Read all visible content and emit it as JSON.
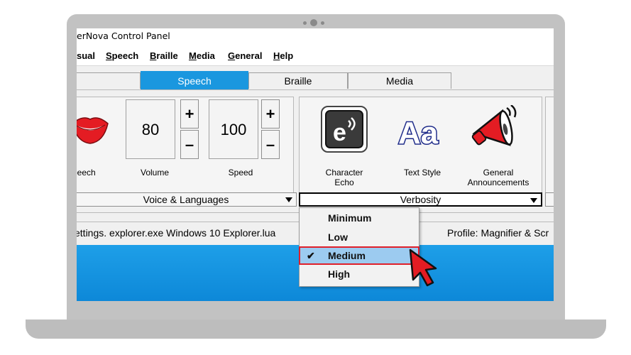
{
  "window": {
    "title": "erNova Control Panel"
  },
  "menu": {
    "items": [
      {
        "pre": "",
        "acc": "",
        "post": "sual"
      },
      {
        "pre": "",
        "acc": "S",
        "post": "peech"
      },
      {
        "pre": "",
        "acc": "B",
        "post": "raille"
      },
      {
        "pre": "",
        "acc": "M",
        "post": "edia"
      },
      {
        "pre": "",
        "acc": "G",
        "post": "eneral"
      },
      {
        "pre": "",
        "acc": "H",
        "post": "elp"
      }
    ]
  },
  "tabs": [
    {
      "label": "Speech",
      "active": true
    },
    {
      "label": "Braille",
      "active": false
    },
    {
      "label": "Media",
      "active": false
    }
  ],
  "voice_group": {
    "speech_label": "peech",
    "volume": {
      "value": "80",
      "label": "Volume",
      "plus": "+",
      "minus": "–"
    },
    "speed": {
      "value": "100",
      "label": "Speed",
      "plus": "+",
      "minus": "–"
    },
    "combo_label": "Voice & Languages"
  },
  "verbosity_group": {
    "character_echo": "Character Echo",
    "text_style": "Text Style",
    "general_announcements": "General Announcements",
    "combo_label": "Verbosity"
  },
  "dropdown": {
    "options": [
      {
        "label": "Minimum",
        "selected": false
      },
      {
        "label": "Low",
        "selected": false
      },
      {
        "label": "Medium",
        "selected": true
      },
      {
        "label": "High",
        "selected": false
      }
    ],
    "check": "✔"
  },
  "status": {
    "left": "ettings. explorer.exe Windows 10 Explorer.lua",
    "right": "Profile: Magnifier & Scr"
  },
  "colors": {
    "accent": "#1a97df",
    "selection_highlight": "#9ccbf0",
    "selection_outline": "#e0202a",
    "taskbar": "#0d88d8",
    "cursor": "#e41c23"
  }
}
